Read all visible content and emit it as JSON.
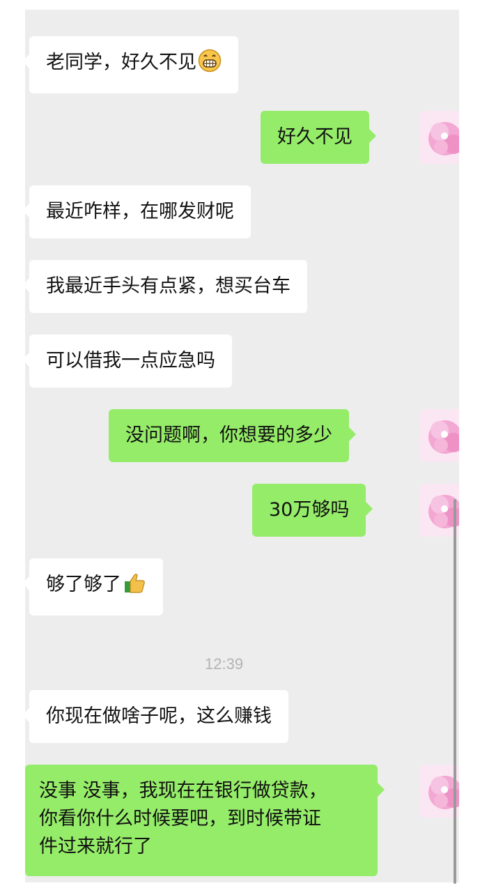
{
  "messages": [
    {
      "side": "in",
      "text": "老同学，好久不见",
      "emoji": "grinning-emoji"
    },
    {
      "side": "out",
      "text": "好久不见"
    },
    {
      "side": "in",
      "text": "最近咋样，在哪发财呢"
    },
    {
      "side": "in",
      "text": "我最近手头有点紧，想买台车"
    },
    {
      "side": "in",
      "text": "可以借我一点应急吗"
    },
    {
      "side": "out",
      "text": "没问题啊，你想要的多少"
    },
    {
      "side": "out",
      "text": "30万够吗"
    },
    {
      "side": "in",
      "text": "够了够了",
      "emoji": "thumbs-up-emoji"
    },
    {
      "side": "in",
      "text": "你现在做啥子呢，这么赚钱"
    },
    {
      "side": "out",
      "lines": [
        "没事 没事，我现在在银行做贷款，",
        "你看你什么时候要吧，到时候带证",
        "件过来就行了"
      ]
    }
  ],
  "timestamp": "12:39",
  "colors": {
    "chat_background": "#ededed",
    "incoming_bubble": "#ffffff",
    "outgoing_bubble": "#95ec69",
    "timestamp_text": "#b3b3b3"
  }
}
